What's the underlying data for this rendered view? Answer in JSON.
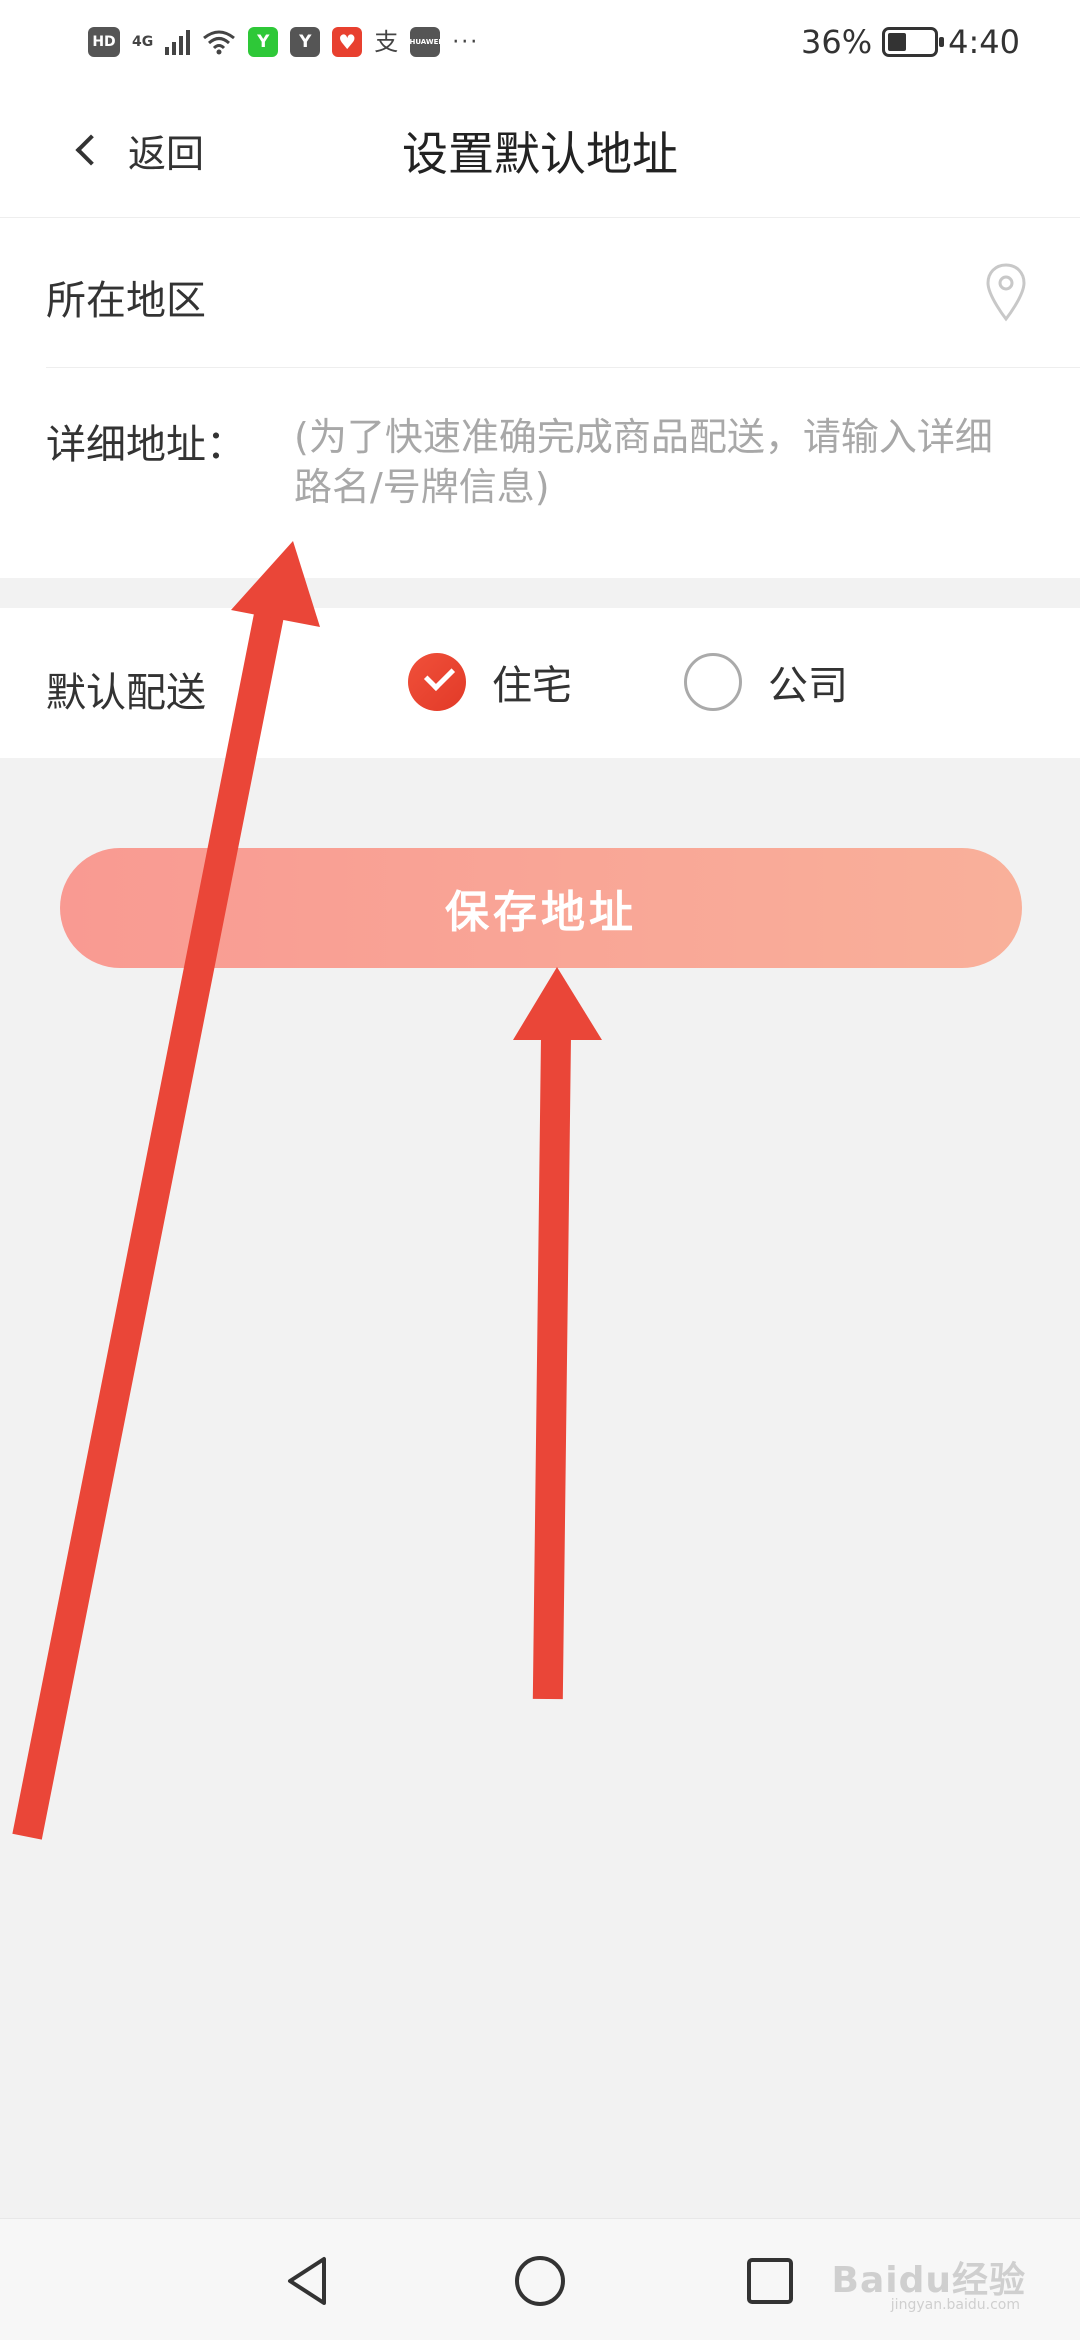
{
  "status_bar": {
    "hd": "HD",
    "network": "4G",
    "app_badge_1": "Y",
    "app_badge_2": "Y",
    "app_badge_4": "支",
    "app_badge_5": "HUAWEI",
    "more": "···",
    "battery_text": "36%",
    "battery_level": 0.36,
    "time": "4:40"
  },
  "nav": {
    "back_label": "返回",
    "title": "设置默认地址"
  },
  "address": {
    "region_label": "所在地区",
    "detail_label": "详细地址：",
    "detail_placeholder": "(为了快速准确完成商品配送，请输入详细路名/号牌信息)",
    "detail_value": ""
  },
  "delivery": {
    "label": "默认配送",
    "options": [
      {
        "label": "住宅",
        "selected": true
      },
      {
        "label": "公司",
        "selected": false
      }
    ]
  },
  "save_button": {
    "label": "保存地址"
  },
  "watermark": {
    "brand": "Baidu经验",
    "domain": "jingyan.baidu.com"
  },
  "colors": {
    "accent_red": "#e8402f",
    "button_gradient_start": "#f99a92",
    "button_gradient_end": "#f9b09a",
    "annotation_arrow": "#ea4638",
    "background": "#f2f2f2"
  },
  "icons": {
    "back": "chevron-left-icon",
    "region": "location-pin-icon",
    "nav_back": "triangle-back-icon",
    "nav_home": "circle-home-icon",
    "nav_recent": "square-recent-icon"
  }
}
